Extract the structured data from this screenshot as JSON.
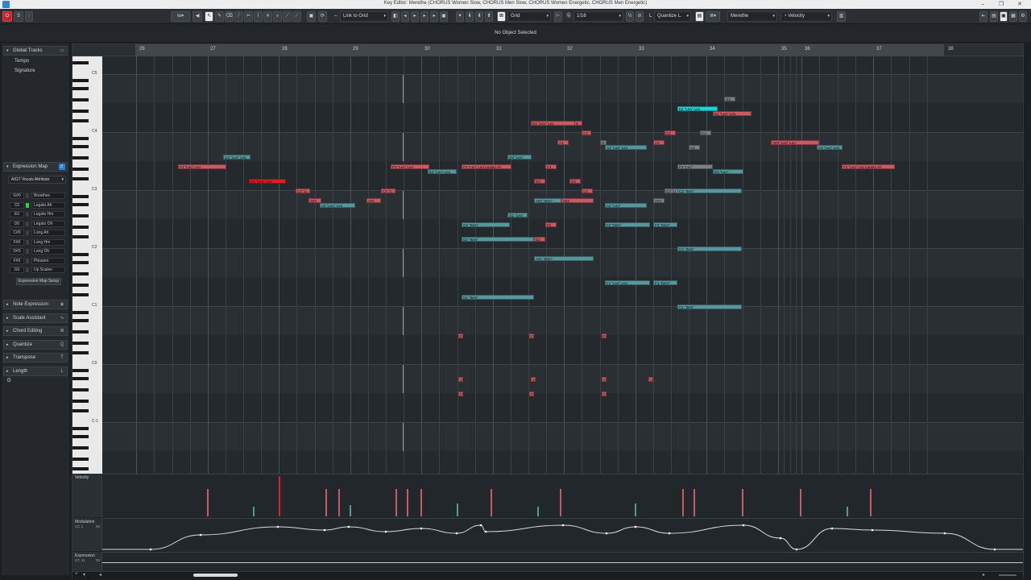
{
  "window": {
    "title": "Key Editor: Merethe (CHORUS Women Slow, CHORUS Men Slow, CHORUS Women Energetic, CHORUS Men Energetic)",
    "minimize": "–",
    "restore": "❐",
    "close": "✕"
  },
  "toolbar": {
    "link_to_grid": "Link to Grid",
    "grid_type": "Grid",
    "quantize_value": "1/16",
    "quantize_length": "Quantize L.",
    "track_name": "Merethe",
    "controller": "Velocity"
  },
  "info_line": {
    "status": "No Object Selected"
  },
  "inspector": {
    "global_tracks": {
      "label": "Global Tracks",
      "items": [
        "Tempo",
        "Signature"
      ]
    },
    "expression_map": {
      "label": "Expression Map",
      "selected_map": "AIGT Vocals Attribute",
      "articulations": [
        {
          "key": "G#0",
          "name": "Breathes",
          "active": false
        },
        {
          "key": "C0",
          "name": "Legato Ah",
          "active": true
        },
        {
          "key": "E0",
          "name": "Legato Hm",
          "active": false
        },
        {
          "key": "D0",
          "name": "Legato Oh",
          "active": false
        },
        {
          "key": "C#0",
          "name": "Long Ah",
          "active": false
        },
        {
          "key": "F#0",
          "name": "Long Hm",
          "active": false
        },
        {
          "key": "D#0",
          "name": "Long Oh",
          "active": false
        },
        {
          "key": "F#0",
          "name": "Phrases",
          "active": false
        },
        {
          "key": "G0",
          "name": "Up Scales",
          "active": false
        }
      ],
      "setup_button": "Expression Map Setup"
    },
    "sections": [
      "Note Expression",
      "Scale Assistant",
      "Chord Editing",
      "Quantize",
      "Transpose",
      "Length"
    ]
  },
  "ruler": {
    "bars": [
      "26",
      "27",
      "28",
      "29",
      "30",
      "31",
      "32",
      "33",
      "34",
      "35",
      "36",
      "37",
      "38"
    ]
  },
  "keyboard": {
    "octave_labels": [
      "C5",
      "C4",
      "C3",
      "C2",
      "C1",
      "C0",
      "C-1"
    ]
  },
  "notes": [
    {
      "label": "F3 \"Leo\" Leo",
      "color": "p"
    },
    {
      "label": "G3 \"Leo\" Leo",
      "color": "t"
    },
    {
      "label": "D3 \"Leo\" Leo",
      "color": "r"
    },
    {
      "label": "C3 \"Li",
      "color": "p"
    },
    {
      "label": "A#2",
      "color": "p"
    },
    {
      "label": "A2 \"Leo\" Leo",
      "color": "t"
    },
    {
      "label": "A#1",
      "color": "p"
    },
    {
      "label": "F3 \"Leo\" Leo",
      "color": "p"
    },
    {
      "label": "E3 \"Leo\" Leo",
      "color": "t"
    },
    {
      "label": "C3 \"Li",
      "color": "p"
    },
    {
      "label": "F3 \"Leo\" Leo Legato Ah",
      "color": "p"
    },
    {
      "label": "G2 \"Item\"",
      "color": "t"
    },
    {
      "label": "D2 \"Item\"",
      "color": "t"
    },
    {
      "label": "D1 \"Item\"",
      "color": "t"
    },
    {
      "label": "G3 \"Leo\"",
      "color": "t"
    },
    {
      "label": "G2 \"Leo\"",
      "color": "t"
    },
    {
      "label": "D4 \"Leo\" Leo",
      "color": "p"
    },
    {
      "label": "E",
      "color": "p"
    },
    {
      "label": "C4",
      "color": "p"
    },
    {
      "label": "A3",
      "color": "p"
    },
    {
      "label": "F3",
      "color": "p"
    },
    {
      "label": "D3",
      "color": "p"
    },
    {
      "label": "A#2 \"Item\"",
      "color": "t"
    },
    {
      "label": "A#2",
      "color": "p"
    },
    {
      "label": "F2",
      "color": "p"
    },
    {
      "label": "D2",
      "color": "p"
    },
    {
      "label": "A#1 \"Item\"",
      "color": "t"
    },
    {
      "label": "D3",
      "color": "p"
    },
    {
      "label": "C3",
      "color": "p"
    },
    {
      "label": "G",
      "color": "g"
    },
    {
      "label": "A3 \"Leo\" Leo",
      "color": "t"
    },
    {
      "label": "A2 \"Leo\"",
      "color": "t"
    },
    {
      "label": "F2 \"Item\"",
      "color": "t"
    },
    {
      "label": "F1 \"Leo\" Leo",
      "color": "t"
    },
    {
      "label": "C4",
      "color": "p"
    },
    {
      "label": "A3",
      "color": "p"
    },
    {
      "label": "A#2",
      "color": "g"
    },
    {
      "label": "F2 \"Item\"",
      "color": "t"
    },
    {
      "label": "F1 \"Item\"",
      "color": "t"
    },
    {
      "label": "E4 \"Leo\" Leo",
      "color": "c"
    },
    {
      "label": "G4",
      "color": "g"
    },
    {
      "label": "E4 \"Leo\" Leo",
      "color": "p"
    },
    {
      "label": "C4",
      "color": "g"
    },
    {
      "label": "A3",
      "color": "g"
    },
    {
      "label": "F3 \"Leo\"",
      "color": "g"
    },
    {
      "label": "E3 \"Leo\"",
      "color": "t"
    },
    {
      "label": "C3 \"Li",
      "color": "g"
    },
    {
      "label": "C3 \"Item\"",
      "color": "t"
    },
    {
      "label": "C2 \"Item\"",
      "color": "t"
    },
    {
      "label": "C1 \"Item\"",
      "color": "t"
    },
    {
      "label": "A#3 \"Leo\" Leo",
      "color": "p"
    },
    {
      "label": "A3 \"Leo\" Leo",
      "color": "t"
    },
    {
      "label": "F3 \"Leo\" Leo Legato Ah",
      "color": "p"
    },
    {
      "label": "F",
      "color": "p"
    },
    {
      "label": "F",
      "color": "p"
    },
    {
      "label": "F",
      "color": "p"
    },
    {
      "label": "A",
      "color": "p"
    },
    {
      "label": "A",
      "color": "p"
    },
    {
      "label": "A",
      "color": "p"
    },
    {
      "label": "A",
      "color": "p"
    },
    {
      "label": "F",
      "color": "p"
    },
    {
      "label": "F",
      "color": "p"
    },
    {
      "label": "F",
      "color": "p"
    }
  ],
  "lanes": {
    "velocity": {
      "label": "Velocity"
    },
    "modulation": {
      "label": "Modulation",
      "cc": "CC 1",
      "value": "96"
    },
    "expression": {
      "label": "Expression",
      "cc": "CC 11",
      "value": "93"
    }
  },
  "colors": {
    "pink": "#c85b62",
    "teal": "#57979b",
    "cyan": "#1fd2d8",
    "red": "#e01c2a",
    "gray": "#7b8287"
  }
}
